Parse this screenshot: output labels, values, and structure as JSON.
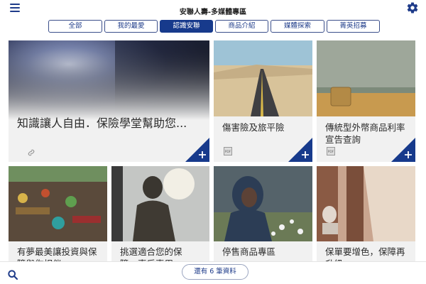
{
  "header": {
    "title": "安聯人壽-多媒體專區",
    "menu_icon": "hamburger-menu-icon",
    "settings_icon": "gear-icon"
  },
  "tabs": [
    {
      "label": "全部",
      "active": false
    },
    {
      "label": "我的最愛",
      "active": false
    },
    {
      "label": "認識安聯",
      "active": true
    },
    {
      "label": "商品介紹",
      "active": false
    },
    {
      "label": "媒體探索",
      "active": false
    },
    {
      "label": "菁英招募",
      "active": false
    }
  ],
  "cards": [
    {
      "title": "知識讓人自由．保險學堂幫助您...",
      "icon": "link-icon"
    },
    {
      "title": "傷害險及旅平險",
      "icon": "pdf-icon"
    },
    {
      "title": "傳統型外幣商品利率宣告查詢",
      "icon": "pdf-icon"
    },
    {
      "title": "有夢最美讓投資與保障與你相伴"
    },
    {
      "title": "挑選適合您的保障，事后專用"
    },
    {
      "title": "停售商品專區"
    },
    {
      "title": "保單要增色，保障再升級"
    }
  ],
  "footer": {
    "count_label": "還有 6 筆資料",
    "search_icon": "search-icon"
  },
  "colors": {
    "brand_blue": "#173a8c",
    "card_bg": "#f1f1f1"
  }
}
